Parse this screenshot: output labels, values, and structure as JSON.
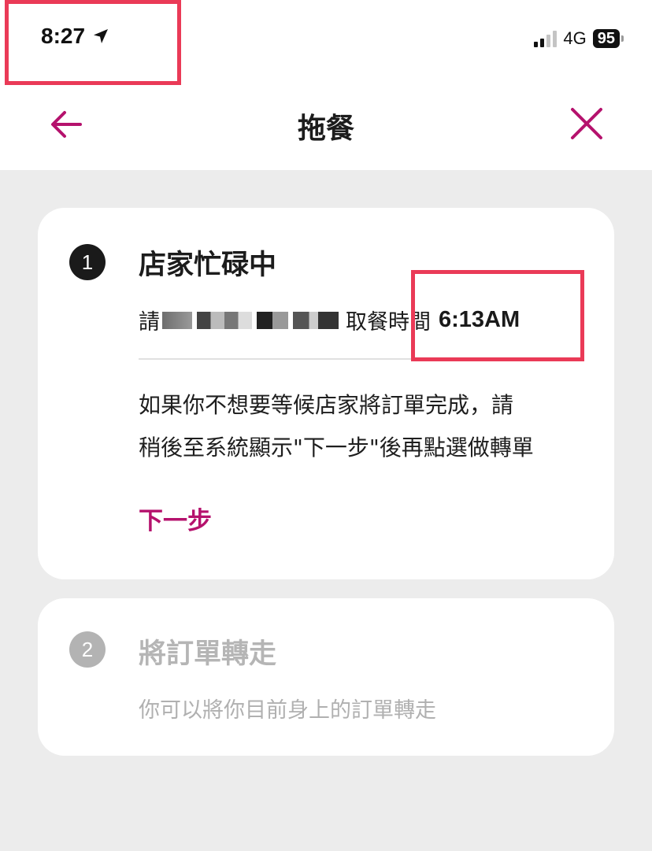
{
  "status_bar": {
    "time": "8:27",
    "network": "4G",
    "battery": "95"
  },
  "nav": {
    "title": "拖餐"
  },
  "steps": [
    {
      "number": "1",
      "title": "店家忙碌中",
      "wait_prefix": "請",
      "pickup_label": "取餐時間",
      "pickup_time": "6:13AM",
      "description_line1": "如果你不想要等候店家將訂單完成，請",
      "description_line2": "稍後至系統顯示\"下一步\"後再點選做轉單",
      "next_label": "下一步"
    },
    {
      "number": "2",
      "title": "將訂單轉走",
      "description": "你可以將你目前身上的訂單轉走"
    }
  ],
  "colors": {
    "accent": "#b5126d",
    "highlight_box": "#ea3a57",
    "background": "#ececec"
  }
}
